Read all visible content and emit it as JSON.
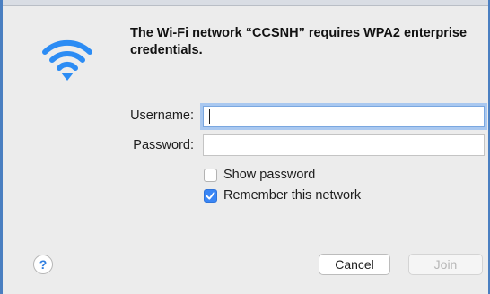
{
  "dialog": {
    "title": "The Wi-Fi network “CCSNH” requires WPA2 enterprise credentials.",
    "icon": "wifi-icon"
  },
  "form": {
    "username_label": "Username:",
    "username_value": "",
    "password_label": "Password:",
    "password_value": ""
  },
  "options": {
    "show_password_label": "Show password",
    "show_password_checked": false,
    "remember_label": "Remember this network",
    "remember_checked": true
  },
  "buttons": {
    "help_label": "?",
    "cancel_label": "Cancel",
    "join_label": "Join",
    "join_enabled": false
  },
  "colors": {
    "accent": "#3a86f5",
    "wifi": "#2c8cf4",
    "focus_ring": "#a9c8f0"
  }
}
